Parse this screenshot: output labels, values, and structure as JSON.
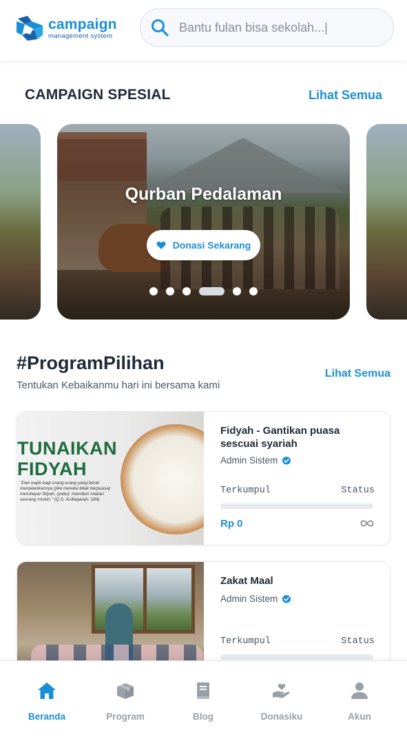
{
  "header": {
    "logo_title": "campaign",
    "logo_subtitle": "management system",
    "search_placeholder": "Bantu fulan bisa sekolah...|"
  },
  "campaign_spesial": {
    "title": "CAMPAIGN SPESIAL",
    "see_all": "Lihat Semua",
    "slide": {
      "title": "Qurban Pedalaman",
      "button_label": "Donasi Sekarang"
    },
    "dots": {
      "count": 6,
      "active_index": 3
    }
  },
  "program_pilihan": {
    "title": "#ProgramPilihan",
    "subtitle": "Tentukan Kebaikanmu hari ini bersama kami",
    "see_all": "Lihat Semua",
    "cards": [
      {
        "title": "Fidyah - Gantikan puasa sescuai syariah",
        "author": "Admin Sistem",
        "collected_label": "Terkumpul",
        "status_label": "Status",
        "amount": "Rp 0",
        "progress": 0,
        "image_text": {
          "line1": "TUNAIKAN",
          "line2": "FIDYAH",
          "verse": "\"Dan wajib bagi orang-orang yang berat menjalankannya (jika mereka tidak berpuasa) membayar fidyah, (yaitu): memberi makan seorang miskin.\" (Q.S. Al-Baqarah: 184)"
        }
      },
      {
        "title": "Zakat Maal",
        "author": "Admin Sistem",
        "collected_label": "Terkumpul",
        "status_label": "Status",
        "progress": 0
      }
    ]
  },
  "bottom_nav": {
    "items": [
      {
        "label": "Beranda",
        "icon": "home-icon",
        "active": true
      },
      {
        "label": "Program",
        "icon": "box-icon",
        "active": false
      },
      {
        "label": "Blog",
        "icon": "book-icon",
        "active": false
      },
      {
        "label": "Donasiku",
        "icon": "hand-heart-icon",
        "active": false
      },
      {
        "label": "Akun",
        "icon": "user-icon",
        "active": false
      }
    ]
  },
  "colors": {
    "accent": "#1b8fd6",
    "text_dark": "#1f2937",
    "text_muted": "#4b5563",
    "nav_inactive": "#9aa0a7",
    "verified": "#1b8fd6"
  }
}
